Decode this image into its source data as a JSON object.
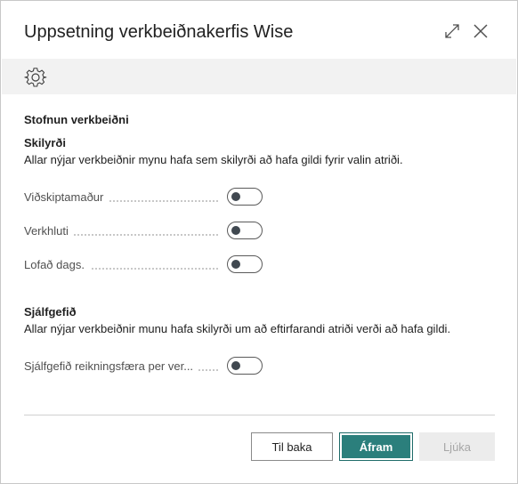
{
  "dialog": {
    "title": "Uppsetning verkbeiðnakerfis Wise",
    "expand_icon": "expand-icon",
    "close_icon": "close-icon"
  },
  "toolbar": {
    "settings_icon": "gear-icon"
  },
  "section": {
    "title": "Stofnun verkbeiðni"
  },
  "required_group": {
    "title": "Skilyrði",
    "description": "Allar nýjar verkbeiðnir mynu hafa sem skilyrði að hafa gildi fyrir valin atriði.",
    "fields": [
      {
        "label": "Viðskiptamaður",
        "enabled": false
      },
      {
        "label": "Verkhluti",
        "enabled": false
      },
      {
        "label": "Lofað dags.",
        "enabled": false
      }
    ]
  },
  "default_group": {
    "title": "Sjálfgefið",
    "description": "Allar nýjar verkbeiðnir munu hafa skilyrði um að eftirfarandi atriði verði að hafa gildi.",
    "fields": [
      {
        "label": "Sjálfgefið reikningsfæra per ver...",
        "enabled": false
      }
    ]
  },
  "footer": {
    "back_label": "Til baka",
    "next_label": "Áfram",
    "finish_label": "Ljúka"
  },
  "colors": {
    "primary_button": "#2b7f7c",
    "toolbar_bg": "#f2f2f2"
  }
}
